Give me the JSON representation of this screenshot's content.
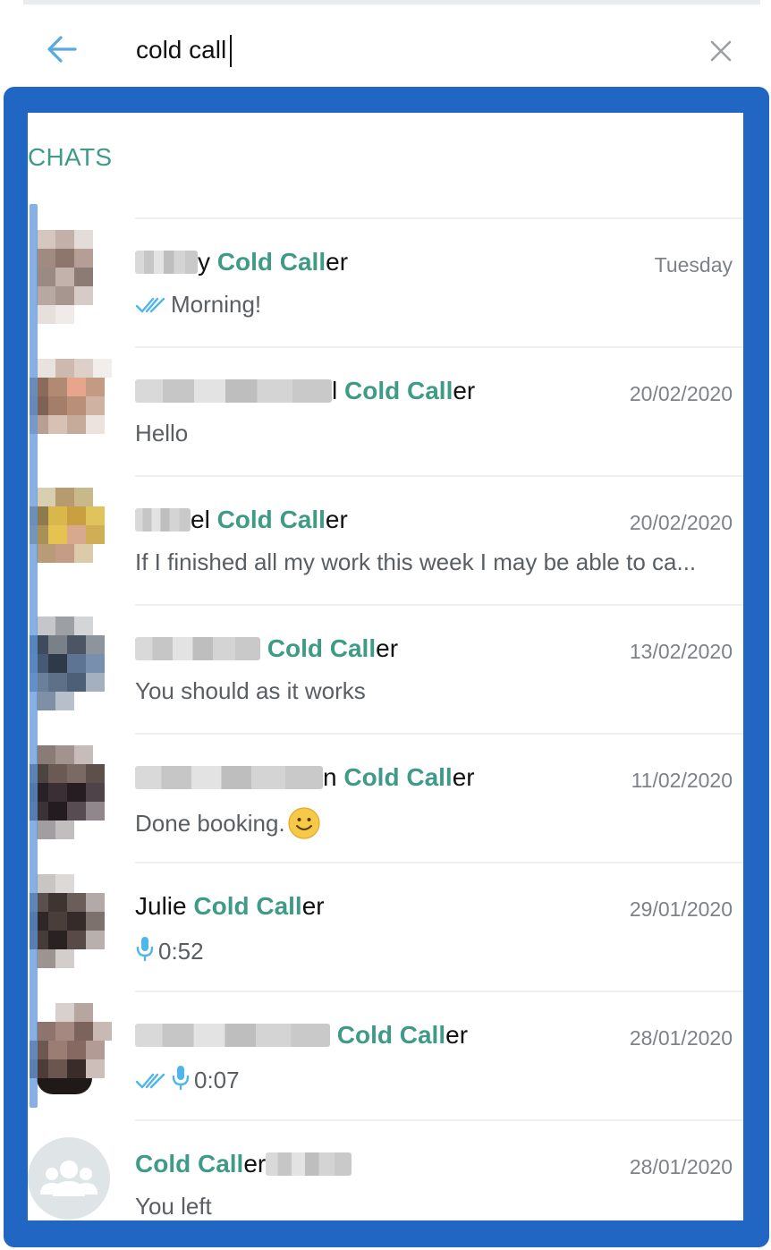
{
  "search": {
    "query": "cold call"
  },
  "sections": {
    "chats_label": "CHATS"
  },
  "colors": {
    "accent": "#3f9b88",
    "frame": "#2166c3",
    "tick": "#4fb6ec"
  },
  "icons": {
    "back": "arrow-left-icon",
    "clear": "close-icon",
    "read": "double-check-icon",
    "voice": "microphone-icon",
    "group": "group-icon",
    "emoji": "smiley-icon"
  },
  "chats": [
    {
      "name_suffix": "y",
      "name_match": "Cold Call",
      "name_rest": "er",
      "date": "Tuesday",
      "preview": "Morning!"
    },
    {
      "name_suffix": "l",
      "name_match": "Cold Call",
      "name_rest": "er",
      "date": "20/02/2020",
      "preview": "Hello"
    },
    {
      "name_suffix": "el",
      "name_match": "Cold Call",
      "name_rest": "er",
      "date": "20/02/2020",
      "preview": "If I finished all my work this week I may be able to ca..."
    },
    {
      "name_suffix": "",
      "name_match": "Cold Call",
      "name_rest": "er",
      "date": "13/02/2020",
      "preview": "You should as it works"
    },
    {
      "name_suffix": "n",
      "name_match": "Cold Call",
      "name_rest": "er",
      "date": "11/02/2020",
      "preview": "Done booking."
    },
    {
      "name_prefix": "Julie",
      "name_match": "Cold Call",
      "name_rest": "er",
      "date": "29/01/2020",
      "preview": "0:52"
    },
    {
      "name_suffix": "",
      "name_match": "Cold Call",
      "name_rest": "er",
      "date": "28/01/2020",
      "preview": "0:07"
    },
    {
      "name_match": "Cold Call",
      "name_rest": "er",
      "date": "28/01/2020",
      "preview": "You left"
    }
  ]
}
